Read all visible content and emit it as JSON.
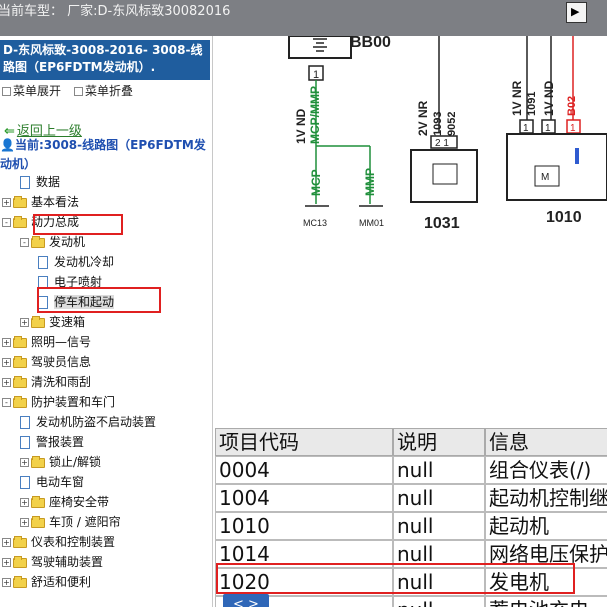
{
  "header": {
    "label": "当前车型：  厂家:D-东风标致30082016",
    "exit_icon": "exit-icon"
  },
  "sidebar": {
    "doc_title": "D-东风标致-3008-2016- 3008-线路图（EP6FDTM发动机）.",
    "expand_all": "菜单展开",
    "collapse_all": "菜单折叠",
    "back": "返回上一级",
    "current": "当前:3008-线路图（EP6FDTM发动机）",
    "tree": [
      {
        "label": "数据",
        "type": "doc",
        "level": 1
      },
      {
        "label": "基本看法",
        "type": "folder",
        "level": 0,
        "state": "+"
      },
      {
        "label": "动力总成",
        "type": "folder",
        "level": 0,
        "state": "-"
      },
      {
        "label": "发动机",
        "type": "folder",
        "level": 1,
        "state": "-"
      },
      {
        "label": "发动机冷却",
        "type": "doc",
        "level": 2
      },
      {
        "label": "电子喷射",
        "type": "doc",
        "level": 2
      },
      {
        "label": "停车和起动",
        "type": "doc",
        "level": 2
      },
      {
        "label": "变速箱",
        "type": "folder",
        "level": 1,
        "state": "+"
      },
      {
        "label": "照明—信号",
        "type": "folder",
        "level": 0,
        "state": "+"
      },
      {
        "label": "驾驶员信息",
        "type": "folder",
        "level": 0,
        "state": "+"
      },
      {
        "label": "清洗和雨刮",
        "type": "folder",
        "level": 0,
        "state": "+"
      },
      {
        "label": "防护装置和车门",
        "type": "folder",
        "level": 0,
        "state": "-"
      },
      {
        "label": "发动机防盗不启动装置",
        "type": "doc",
        "level": 1
      },
      {
        "label": "警报装置",
        "type": "doc",
        "level": 1
      },
      {
        "label": "锁止/解锁",
        "type": "folder",
        "level": 1,
        "state": "+"
      },
      {
        "label": "电动车窗",
        "type": "doc",
        "level": 1
      },
      {
        "label": "座椅安全带",
        "type": "folder",
        "level": 1,
        "state": "+"
      },
      {
        "label": "车顶 / 遮阳帘",
        "type": "folder",
        "level": 1,
        "state": "+"
      },
      {
        "label": "仪表和控制装置",
        "type": "folder",
        "level": 0,
        "state": "+"
      },
      {
        "label": "驾驶辅助装置",
        "type": "folder",
        "level": 0,
        "state": "+"
      },
      {
        "label": "舒适和便利",
        "type": "folder",
        "level": 0,
        "state": "+"
      }
    ]
  },
  "diagram": {
    "bb": "BB00",
    "nd1": "1V ND",
    "mcp_mmp": "MCP/MMP",
    "mcp": "MCP",
    "mmp": "MMP",
    "mc13": "MC13",
    "mm01": "MM01",
    "nr2": "2V NR",
    "w1093": "1093",
    "w9052": "9052",
    "pins_1031": "2 1",
    "c1031": "1031",
    "nr1": "1V NR",
    "w1091": "1091",
    "nd2": "1V ND",
    "b02": "B02",
    "pin1": "1",
    "pin1b": "1",
    "pin1c": "1",
    "c1010": "1010",
    "m": "M"
  },
  "table": {
    "headers": [
      "项目代码",
      "说明",
      "信息"
    ],
    "rows": [
      [
        "0004",
        "null",
        "组合仪表(/)"
      ],
      [
        "1004",
        "null",
        "起动机控制继"
      ],
      [
        "1010",
        "null",
        "起动机"
      ],
      [
        "1014",
        "null",
        "网络电压保护"
      ],
      [
        "1020",
        "null",
        "发电机"
      ],
      [
        "",
        "null",
        "蓄电池充电"
      ]
    ],
    "nav": "< >"
  }
}
